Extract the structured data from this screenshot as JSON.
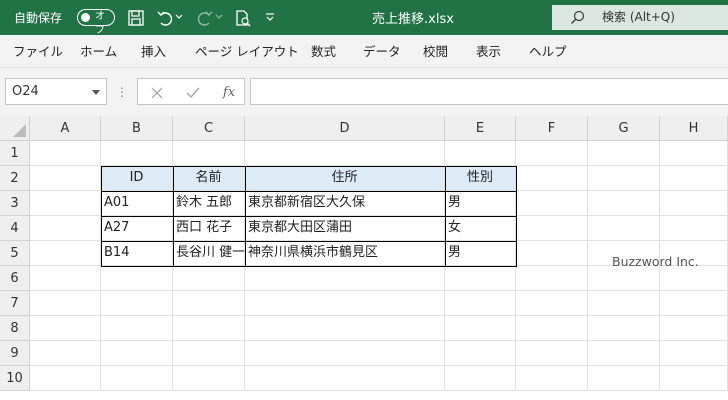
{
  "titlebar": {
    "autosave_label": "自動保存",
    "autosave_state": "オフ",
    "filename": "売上推移.xlsx",
    "search_label": "検索 (Alt+Q)",
    "accent_color": "#217346"
  },
  "ribbon": {
    "tabs": [
      "ファイル",
      "ホーム",
      "挿入",
      "ページ レイアウト",
      "数式",
      "データ",
      "校閲",
      "表示",
      "ヘルプ"
    ]
  },
  "formula_bar": {
    "name_box": "O24",
    "dots": "⋮",
    "fx_label": "fx",
    "content": ""
  },
  "sheet": {
    "columns": [
      "A",
      "B",
      "C",
      "D",
      "E",
      "F",
      "G",
      "H"
    ],
    "rows": [
      "1",
      "2",
      "3",
      "4",
      "5",
      "6",
      "7",
      "8",
      "9",
      "10"
    ],
    "table_header_color": "#ddebf7",
    "table": {
      "headers": [
        "ID",
        "名前",
        "住所",
        "性別"
      ],
      "rows": [
        [
          "A01",
          "鈴木 五郎",
          "東京都新宿区大久保",
          "男"
        ],
        [
          "A27",
          "西口 花子",
          "東京都大田区蒲田",
          "女"
        ],
        [
          "B14",
          "長谷川 健一",
          "神奈川県横浜市鶴見区",
          "男"
        ]
      ]
    }
  },
  "watermark": "Buzzword Inc."
}
